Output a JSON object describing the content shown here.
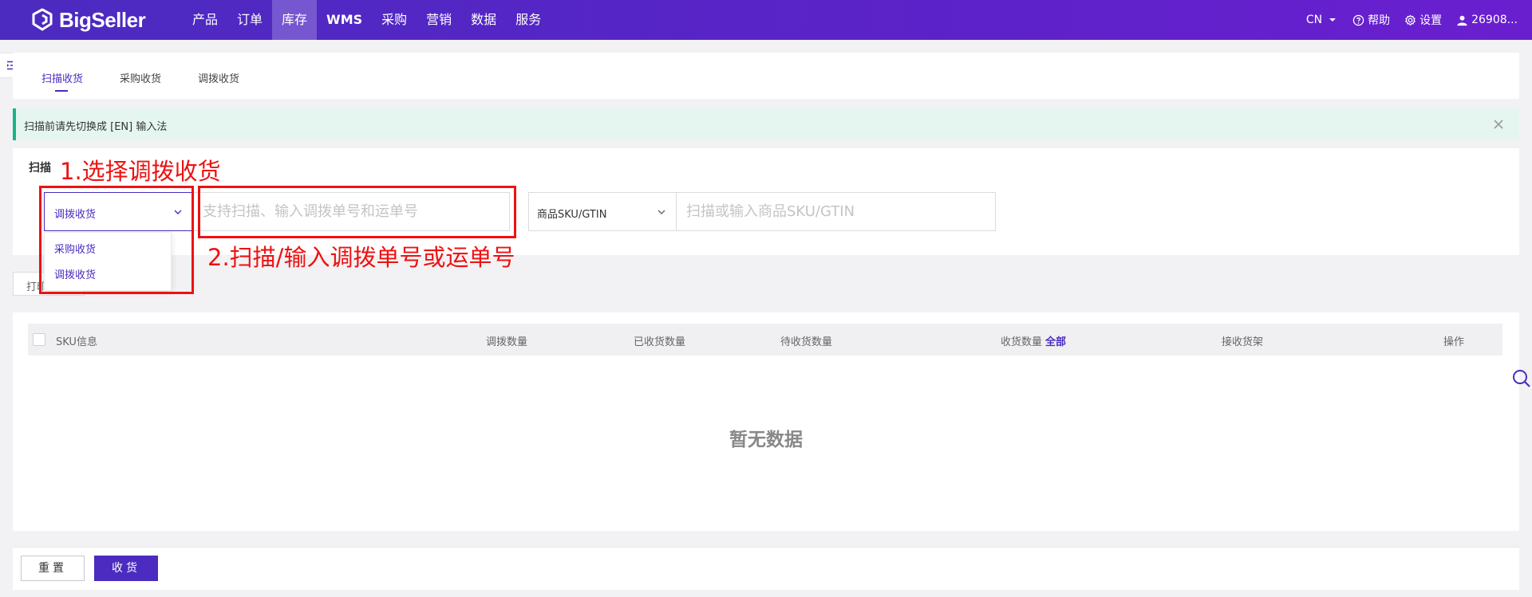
{
  "app": {
    "brand": "BigSeller"
  },
  "nav": {
    "items": [
      {
        "label": "产品"
      },
      {
        "label": "订单"
      },
      {
        "label": "库存"
      },
      {
        "label": "WMS"
      },
      {
        "label": "采购"
      },
      {
        "label": "营销"
      },
      {
        "label": "数据"
      },
      {
        "label": "服务"
      }
    ],
    "active_index": 2
  },
  "topright": {
    "lang": "CN",
    "help": "帮助",
    "settings": "设置",
    "user": "26908..."
  },
  "tabs": [
    {
      "label": "扫描收货"
    },
    {
      "label": "采购收货"
    },
    {
      "label": "调拨收货"
    }
  ],
  "alert": {
    "text": "扫描前请先切换成 [EN] 输入法"
  },
  "scan": {
    "label": "扫描",
    "type_select_value": "调拨收货",
    "order_placeholder": "支持扫描、输入调拨单号和运单号",
    "sku_select_value": "商品SKU/GTIN",
    "sku_placeholder": "扫描或输入商品SKU/GTIN",
    "dropdown_options": [
      {
        "label": "采购收货"
      },
      {
        "label": "调拨收货"
      }
    ]
  },
  "print_button": {
    "label": "打印"
  },
  "table": {
    "columns": {
      "sku": "SKU信息",
      "transfer_qty": "调拨数量",
      "received_qty": "已收货数量",
      "pending_qty": "待收货数量",
      "receive_qty": "收货数量",
      "receive_all": "全部",
      "shelf": "接收货架",
      "action": "操作"
    },
    "empty_text": "暂无数据"
  },
  "footer": {
    "reset": "重置",
    "receive": "收货"
  },
  "annotations": {
    "step1": "1.选择调拨收货",
    "step2": "2.扫描/输入调拨单号或运单号"
  },
  "colors": {
    "brand": "#4b2bc0",
    "annotation": "#ee1111",
    "alert_bar": "#18b48a"
  }
}
